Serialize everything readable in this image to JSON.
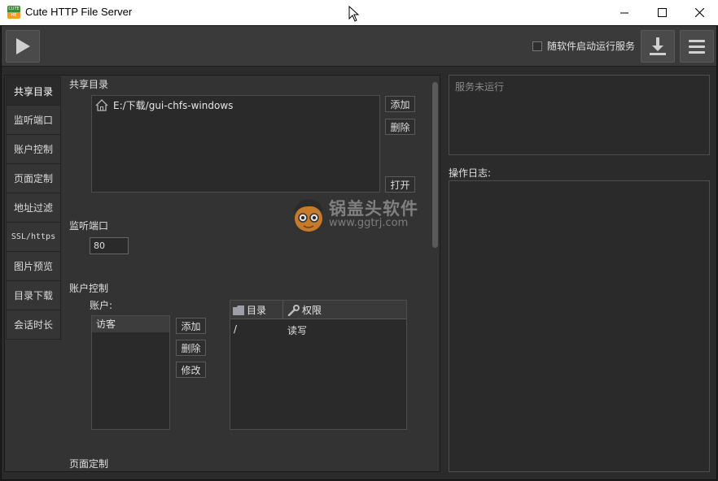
{
  "window": {
    "title": "Cute HTTP File Server",
    "icon_top": "CUTE",
    "icon_bottom": "HE"
  },
  "toolbar": {
    "autostart_label": "随软件启动运行服务",
    "autostart_checked": false
  },
  "tabs": [
    {
      "label": "共享目录",
      "active": true
    },
    {
      "label": "监听端口"
    },
    {
      "label": "账户控制"
    },
    {
      "label": "页面定制"
    },
    {
      "label": "地址过滤"
    },
    {
      "label": "SSL/https"
    },
    {
      "label": "图片预览"
    },
    {
      "label": "目录下载"
    },
    {
      "label": "会话时长"
    }
  ],
  "share": {
    "label": "共享目录",
    "paths": [
      "E:/下载/gui-chfs-windows"
    ],
    "add_label": "添加",
    "delete_label": "删除",
    "open_label": "打开"
  },
  "port": {
    "label": "监听端口",
    "value": "80"
  },
  "accounts": {
    "label": "账户控制",
    "users_label": "账户:",
    "users": [
      "访客"
    ],
    "add_label": "添加",
    "delete_label": "删除",
    "modify_label": "修改",
    "perm_headers": {
      "dir": "目录",
      "perm": "权限"
    },
    "perm_rows": [
      {
        "dir": "/",
        "perm": "读写"
      }
    ]
  },
  "page_custom": {
    "label": "页面定制"
  },
  "status": {
    "text": "服务未运行"
  },
  "log": {
    "label": "操作日志:"
  },
  "watermark": {
    "cn": "锅盖头软件",
    "url": "www.ggtrj.com"
  }
}
